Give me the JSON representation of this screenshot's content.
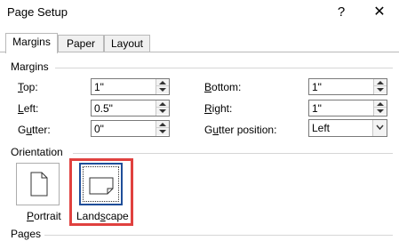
{
  "window": {
    "title": "Page Setup",
    "help_glyph": "?",
    "close_glyph": "✕"
  },
  "tabs": [
    {
      "label": "Margins",
      "active": true
    },
    {
      "label": "Paper",
      "active": false
    },
    {
      "label": "Layout",
      "active": false
    }
  ],
  "margins": {
    "section_label": "Margins",
    "top": {
      "label_key": "T",
      "label_rest": "op:",
      "value": "1\""
    },
    "left": {
      "label_key": "L",
      "label_rest": "eft:",
      "value": "0.5\""
    },
    "gutter": {
      "label_pre": "G",
      "label_key": "u",
      "label_rest": "tter:",
      "value": "0\""
    },
    "bottom": {
      "label_key": "B",
      "label_rest": "ottom:",
      "value": "1\""
    },
    "right": {
      "label_key": "R",
      "label_rest": "ight:",
      "value": "1\""
    },
    "gutter_position": {
      "label_pre": "G",
      "label_key": "u",
      "label_rest": "tter position:",
      "value": "Left"
    }
  },
  "orientation": {
    "section_label": "Orientation",
    "portrait": {
      "label_pre": "",
      "label_key": "P",
      "label_rest": "ortrait"
    },
    "landscape": {
      "label_pre": "Land",
      "label_key": "s",
      "label_rest": "cape",
      "selected": true
    },
    "highlight_color": "#e0413f"
  },
  "pages": {
    "section_label": "Pages"
  }
}
